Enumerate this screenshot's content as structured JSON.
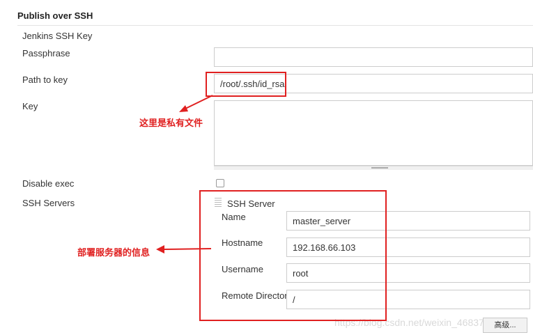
{
  "section": {
    "title": "Publish over SSH"
  },
  "fields": {
    "jenkins_ssh_key_label": "Jenkins SSH Key",
    "passphrase_label": "Passphrase",
    "passphrase_value": "",
    "path_to_key_label": "Path to key",
    "path_to_key_value": "/root/.ssh/id_rsa",
    "key_label": "Key",
    "key_value": "",
    "disable_exec_label": "Disable exec",
    "disable_exec_checked": false,
    "ssh_servers_label": "SSH Servers"
  },
  "ssh_server": {
    "title": "SSH Server",
    "name_label": "Name",
    "name_value": "master_server",
    "hostname_label": "Hostname",
    "hostname_value": "192.168.66.103",
    "username_label": "Username",
    "username_value": "root",
    "remote_directory_label": "Remote Directory",
    "remote_directory_value": "/"
  },
  "buttons": {
    "advanced_label": "高级..."
  },
  "annotations": {
    "private_key_note": "这里是私有文件",
    "server_info_note": "部署服务器的信息",
    "color": "#e02020"
  },
  "watermark": {
    "text": "https://blog.csdn.net/weixin_46837396"
  }
}
